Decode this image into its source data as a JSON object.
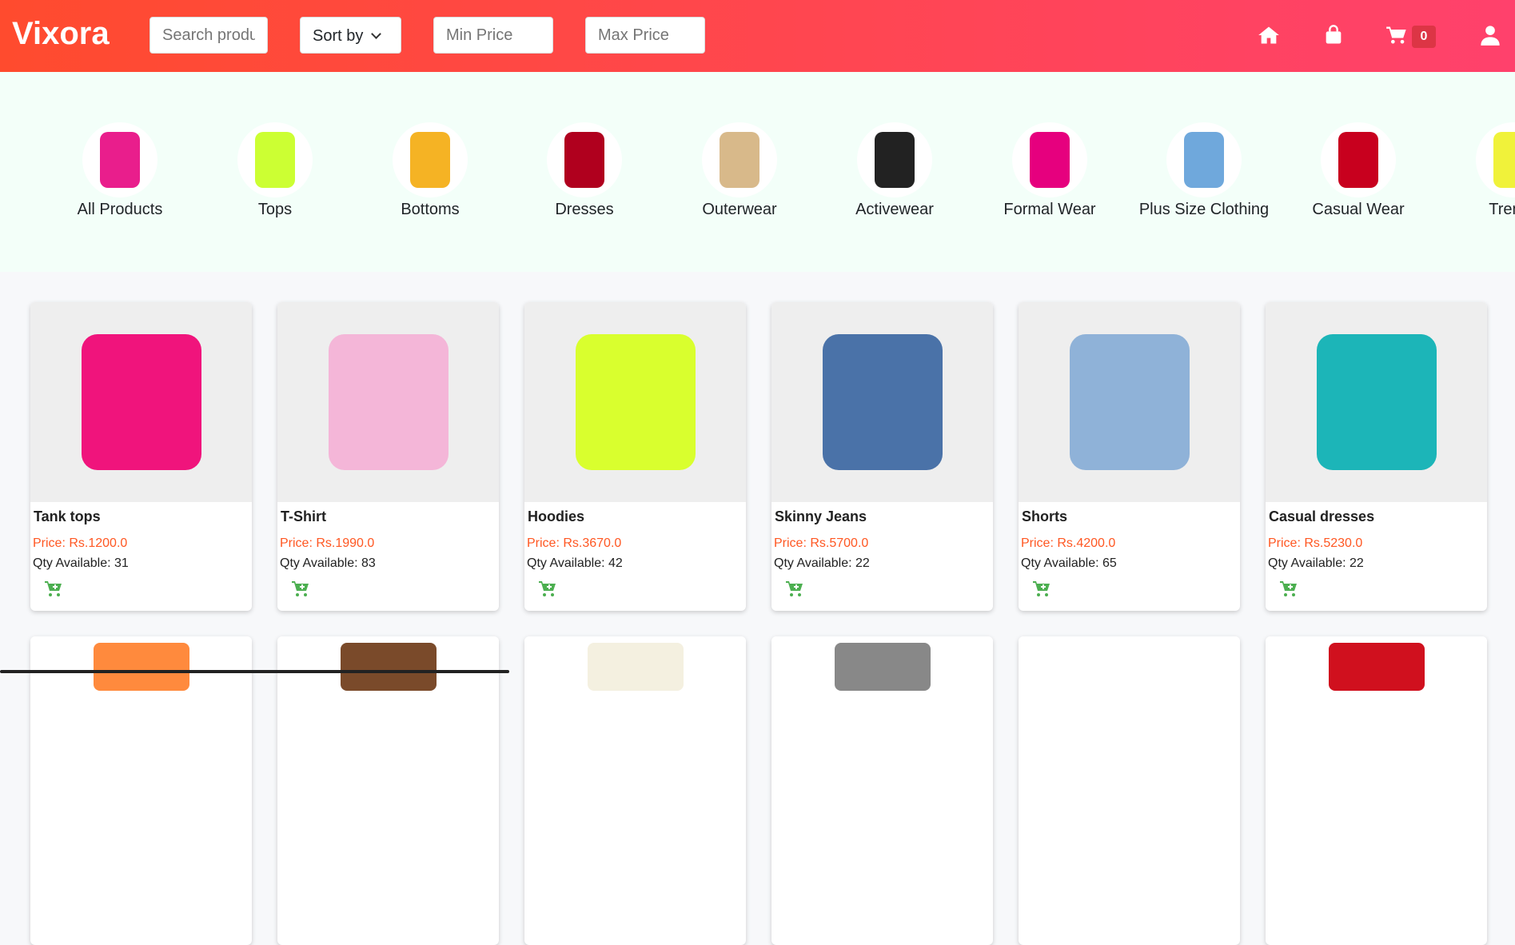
{
  "header": {
    "logo": "Vixora",
    "search_placeholder": "Search products",
    "sort_label": "Sort by",
    "min_placeholder": "Min Price",
    "max_placeholder": "Max Price",
    "cart_count": "0"
  },
  "colors": {
    "header_start": "#ff4b2e",
    "header_end": "#ff416c",
    "price": "#ff5722",
    "add_cart": "#4caf50",
    "badge": "#dc3545"
  },
  "categories": [
    {
      "label": "All Products",
      "color": "#e91e8c"
    },
    {
      "label": "Tops",
      "color": "#ccff33"
    },
    {
      "label": "Bottoms",
      "color": "#f5b324"
    },
    {
      "label": "Dresses",
      "color": "#b0001e"
    },
    {
      "label": "Outerwear",
      "color": "#d8b98a"
    },
    {
      "label": "Activewear",
      "color": "#222222"
    },
    {
      "label": "Formal Wear",
      "color": "#e6007e"
    },
    {
      "label": "Plus Size Clothing",
      "color": "#6fa8dc"
    },
    {
      "label": "Casual Wear",
      "color": "#c8001e"
    },
    {
      "label": "Trendy",
      "color": "#f0f23a"
    }
  ],
  "products": [
    {
      "name": "Tank tops",
      "price": "Price: Rs.1200.0",
      "qty": "Qty Available: 31",
      "color": "#f0147c"
    },
    {
      "name": "T-Shirt",
      "price": "Price: Rs.1990.0",
      "qty": "Qty Available: 83",
      "color": "#f4b6d8"
    },
    {
      "name": "Hoodies",
      "price": "Price: Rs.3670.0",
      "qty": "Qty Available: 42",
      "color": "#d9ff2e"
    },
    {
      "name": "Skinny Jeans",
      "price": "Price: Rs.5700.0",
      "qty": "Qty Available: 22",
      "color": "#4a72a8"
    },
    {
      "name": "Shorts",
      "price": "Price: Rs.4200.0",
      "qty": "Qty Available: 65",
      "color": "#8fb2d8"
    },
    {
      "name": "Casual dresses",
      "price": "Price: Rs.5230.0",
      "qty": "Qty Available: 22",
      "color": "#1cb5b8"
    }
  ],
  "row2_colors": [
    "#ff8a3d",
    "#7a4a2a",
    "#f4f0e0",
    "#888888",
    "#ffffff",
    "#d0101e"
  ]
}
